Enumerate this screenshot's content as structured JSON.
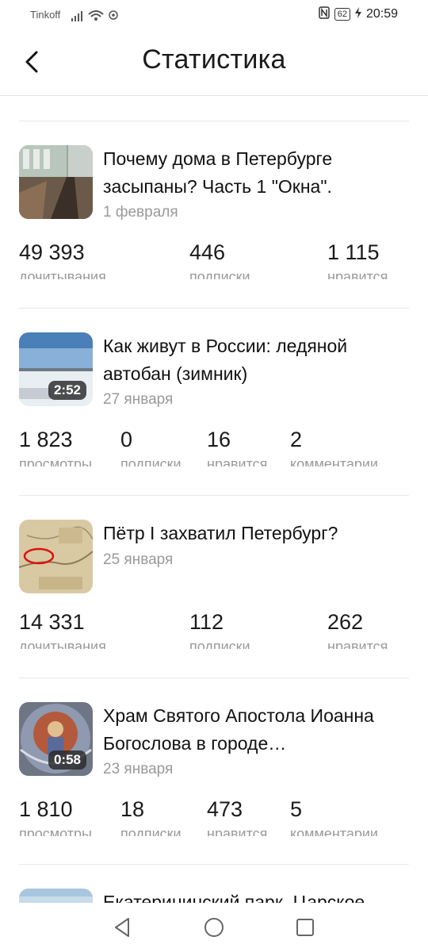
{
  "status": {
    "carrier": "Tinkoff",
    "battery": "62",
    "time": "20:59"
  },
  "header": {
    "title": "Статистика"
  },
  "articles": [
    {
      "title": "Почему дома в Петербурге засыпаны? Часть 1 \"Окна\".",
      "date": "1 февраля",
      "stats": [
        {
          "value": "49 393",
          "label": "дочитывания"
        },
        {
          "value": "446",
          "label": "подписки"
        },
        {
          "value": "1 115",
          "label": "нравится"
        }
      ]
    },
    {
      "title": "Как живут в России: ледяной автобан (зимник)",
      "date": "27 января",
      "duration": "2:52",
      "stats": [
        {
          "value": "1 823",
          "label": "просмотры"
        },
        {
          "value": "0",
          "label": "подписки"
        },
        {
          "value": "16",
          "label": "нравится"
        },
        {
          "value": "2",
          "label": "комментарии"
        }
      ]
    },
    {
      "title": "Пётр I захватил Петербург?",
      "date": "25 января",
      "stats": [
        {
          "value": "14 331",
          "label": "дочитывания"
        },
        {
          "value": "112",
          "label": "подписки"
        },
        {
          "value": "262",
          "label": "нравится"
        }
      ]
    },
    {
      "title": "Храм Святого Апостола Иоанна Богослова в городе…",
      "date": "23 января",
      "duration": "0:58",
      "stats": [
        {
          "value": "1 810",
          "label": "просмотры"
        },
        {
          "value": "18",
          "label": "подписки"
        },
        {
          "value": "473",
          "label": "нравится"
        },
        {
          "value": "5",
          "label": "комментарии"
        }
      ]
    },
    {
      "title": "Екатерининский парк. Царское"
    }
  ],
  "navbar": {
    "icons": [
      "back-triangle-icon",
      "home-circle-icon",
      "recents-square-icon"
    ]
  }
}
